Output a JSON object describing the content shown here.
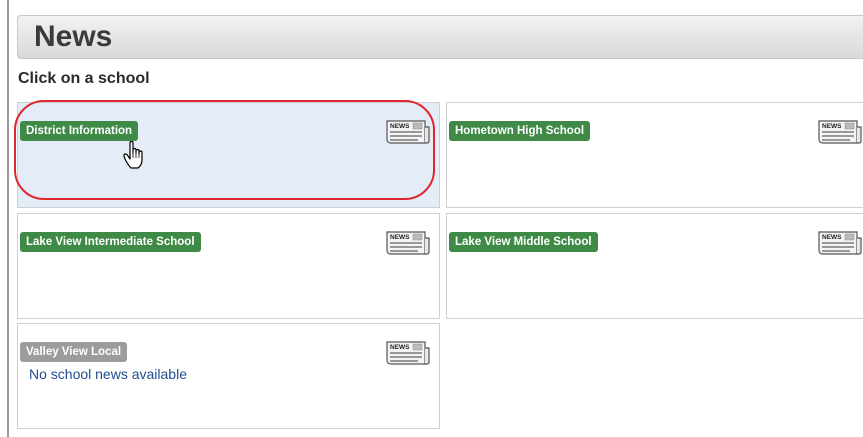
{
  "header": {
    "title": "News"
  },
  "subtitle": "Click on a school",
  "schools": [
    {
      "name": "District Information",
      "status": "active"
    },
    {
      "name": "Hometown High School",
      "status": "active"
    },
    {
      "name": "Lake View Intermediate School",
      "status": "active"
    },
    {
      "name": "Lake View Middle School",
      "status": "active"
    },
    {
      "name": "Valley View Local",
      "status": "inactive",
      "message": "No school news available"
    }
  ],
  "news_icon_text": "NEWS",
  "colors": {
    "badge_active": "#3e8a46",
    "badge_inactive": "#9c9c9c",
    "selected_card": "#e4ecf7",
    "highlight_ring": "#e0262e",
    "message_text": "#1f4e8c"
  },
  "icons": {
    "news": "newspaper-icon",
    "cursor": "hand-pointer-icon"
  }
}
